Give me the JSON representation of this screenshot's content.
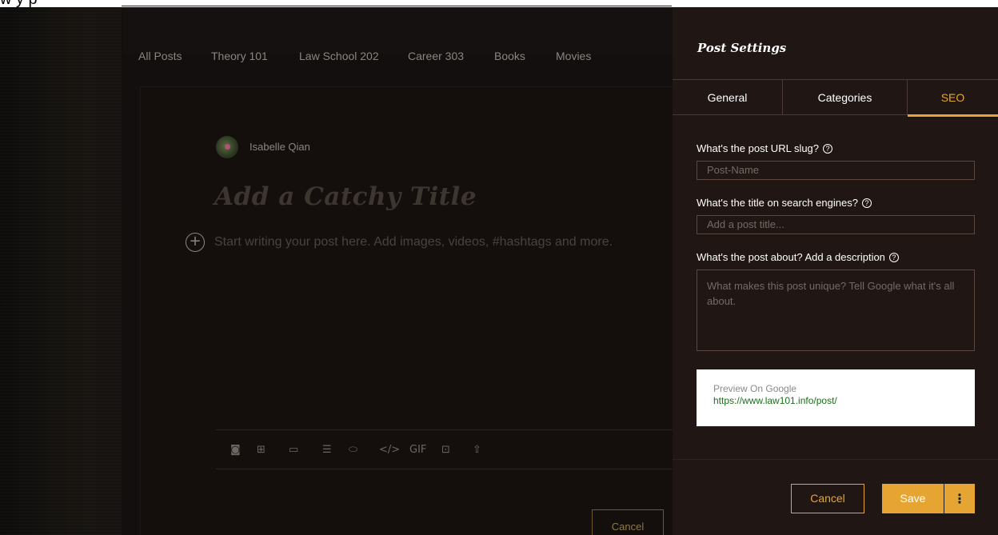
{
  "top_strip": {
    "partial_text": "w y  p"
  },
  "nav": {
    "items": [
      "All Posts",
      "Theory 101",
      "Law School 202",
      "Career 303",
      "Books",
      "Movies"
    ]
  },
  "editor": {
    "author": "Isabelle Qian",
    "title_placeholder": "Add a Catchy Title",
    "body_placeholder": "Start writing your post here. Add images, videos, #hashtags and more.",
    "plus_glyph": "+",
    "toolbar_icons": [
      {
        "name": "camera-icon",
        "glyph": "◙"
      },
      {
        "name": "gallery-icon",
        "glyph": "⊞"
      },
      {
        "name": "video-icon",
        "glyph": "▭"
      },
      {
        "name": "divider-icon",
        "glyph": "☰"
      },
      {
        "name": "button-icon",
        "glyph": "⬭"
      },
      {
        "name": "code-icon",
        "glyph": "</>"
      },
      {
        "name": "gif-icon",
        "glyph": "GIF"
      },
      {
        "name": "embed-icon",
        "glyph": "⊡"
      },
      {
        "name": "upload-icon",
        "glyph": "⇧"
      }
    ],
    "cancel_label": "Cancel"
  },
  "panel": {
    "title": "Post Settings",
    "tabs": [
      "General",
      "Categories",
      "SEO"
    ],
    "active_tab": "SEO",
    "slug_label": "What's the post URL slug?",
    "slug_value": "Post-Name",
    "seo_title_label": "What's the title on search engines?",
    "seo_title_placeholder": "Add a post title...",
    "description_label": "What's the post about? Add a description",
    "description_placeholder": "What makes this post unique? Tell Google what it's all about.",
    "preview_heading": "Preview On Google",
    "preview_url": "https://www.law101.info/post/",
    "help_glyph": "?",
    "cancel_label": "Cancel",
    "save_label": "Save",
    "more_glyph": "⋮"
  },
  "colors": {
    "accent": "#e6a532",
    "panel_bg": "#201714",
    "editor_bg": "#120f0e",
    "preview_url": "#1a6e1a"
  }
}
